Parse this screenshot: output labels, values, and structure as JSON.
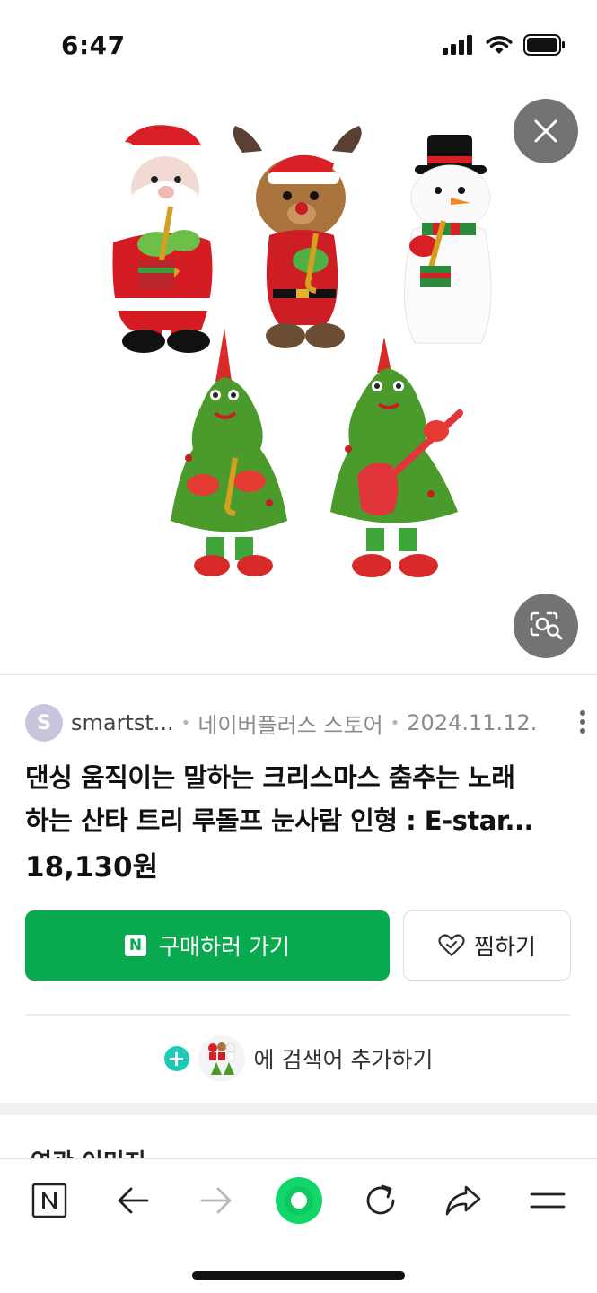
{
  "status_bar": {
    "time": "6:47",
    "icons": [
      "cellular-signal-icon",
      "wifi-icon",
      "battery-icon"
    ]
  },
  "hero": {
    "image_subject": "Christmas plush dolls: Santa, Rudolph reindeer, snowman and two singing trees",
    "buttons": [
      "close-icon",
      "image-search-lens-icon"
    ]
  },
  "meta": {
    "avatar_letter": "S",
    "seller": "smartst...",
    "store_type": "네이버플러스 스토어",
    "date": "2024.11.12."
  },
  "product": {
    "title_line1": "댄싱 움직이는 말하는 크리스마스 춤추는 노래",
    "title_line2": "하는 산타 트리 루돌프 눈사람 인형 : E-star...",
    "price": "18,130원"
  },
  "actions": {
    "buy_badge": "N",
    "buy_label": "구매하러 가기",
    "wish_label": "찜하기",
    "add_keyword_label": "에 검색어 추가하기"
  },
  "next_section": {
    "title": "연관 이미지"
  },
  "toolbar": {
    "items": [
      "naver-home-icon",
      "back-arrow-icon",
      "forward-arrow-icon",
      "green-dot-icon",
      "reload-icon",
      "share-icon",
      "menu-icon"
    ]
  },
  "colors": {
    "buy_green": "#08a94f",
    "add_teal": "#1fc8b8",
    "avatar_lavender": "#c9c5dc",
    "dot_green": "#11d66a"
  }
}
